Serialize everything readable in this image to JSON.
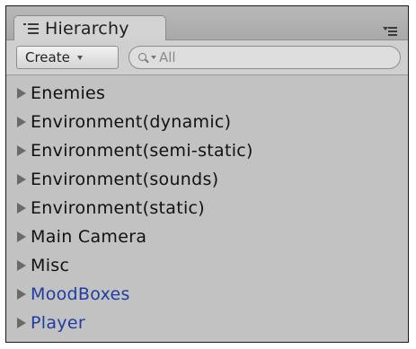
{
  "panel": {
    "tab_title": "Hierarchy",
    "tab_icon": "hierarchy-list-icon",
    "menu_icon": "panel-menu-icon"
  },
  "toolbar": {
    "create_label": "Create",
    "search_placeholder": "All",
    "search_value": ""
  },
  "hierarchy": {
    "items": [
      {
        "label": "Enemies",
        "kind": "object"
      },
      {
        "label": "Environment(dynamic)",
        "kind": "object"
      },
      {
        "label": "Environment(semi-static)",
        "kind": "object"
      },
      {
        "label": "Environment(sounds)",
        "kind": "object"
      },
      {
        "label": "Environment(static)",
        "kind": "object"
      },
      {
        "label": "Main Camera",
        "kind": "object"
      },
      {
        "label": "Misc",
        "kind": "object"
      },
      {
        "label": "MoodBoxes",
        "kind": "prefab"
      },
      {
        "label": "Player",
        "kind": "prefab"
      }
    ]
  },
  "colors": {
    "panel_bg": "#c2c2c2",
    "prefab_text": "#1f3da0",
    "object_text": "#111111"
  }
}
